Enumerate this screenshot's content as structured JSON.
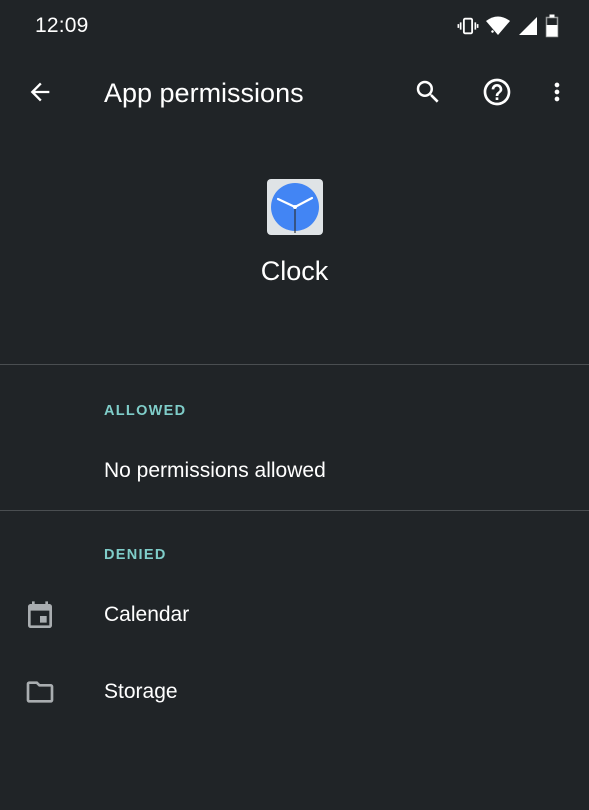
{
  "status_bar": {
    "time": "12:09",
    "icons": [
      "vibrate-icon",
      "wifi-icon",
      "signal-icon",
      "battery-icon"
    ]
  },
  "app_bar": {
    "title": "App permissions",
    "icons": [
      "back-arrow-icon",
      "search-icon",
      "help-icon",
      "more-vert-icon"
    ]
  },
  "app": {
    "name": "Clock",
    "icon": "clock-app-icon"
  },
  "sections": {
    "allowed": {
      "header": "ALLOWED",
      "empty_text": "No permissions allowed"
    },
    "denied": {
      "header": "DENIED",
      "items": [
        {
          "label": "Calendar",
          "icon": "calendar-icon"
        },
        {
          "label": "Storage",
          "icon": "folder-icon"
        }
      ]
    }
  },
  "colors": {
    "background": "#202427",
    "section_header": "#7fcdc9",
    "divider": "#4a4e51",
    "text": "#ffffff",
    "icon_grey": "#a9adb0",
    "clock_blue": "#4285f4"
  }
}
